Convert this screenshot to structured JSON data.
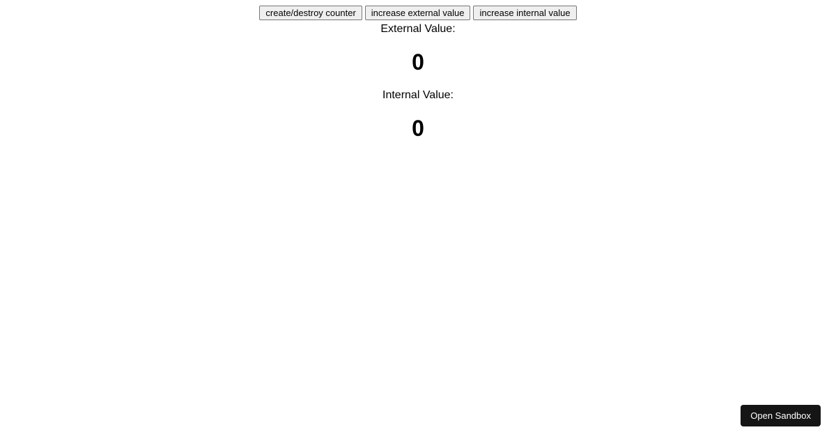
{
  "toolbar": {
    "create_destroy_label": "create/destroy counter",
    "increase_external_label": "increase external value",
    "increase_internal_label": "increase internal value"
  },
  "external": {
    "label": "External Value:",
    "value": "0"
  },
  "internal": {
    "label": "Internal Value:",
    "value": "0"
  },
  "sandbox": {
    "open_label": "Open Sandbox"
  }
}
